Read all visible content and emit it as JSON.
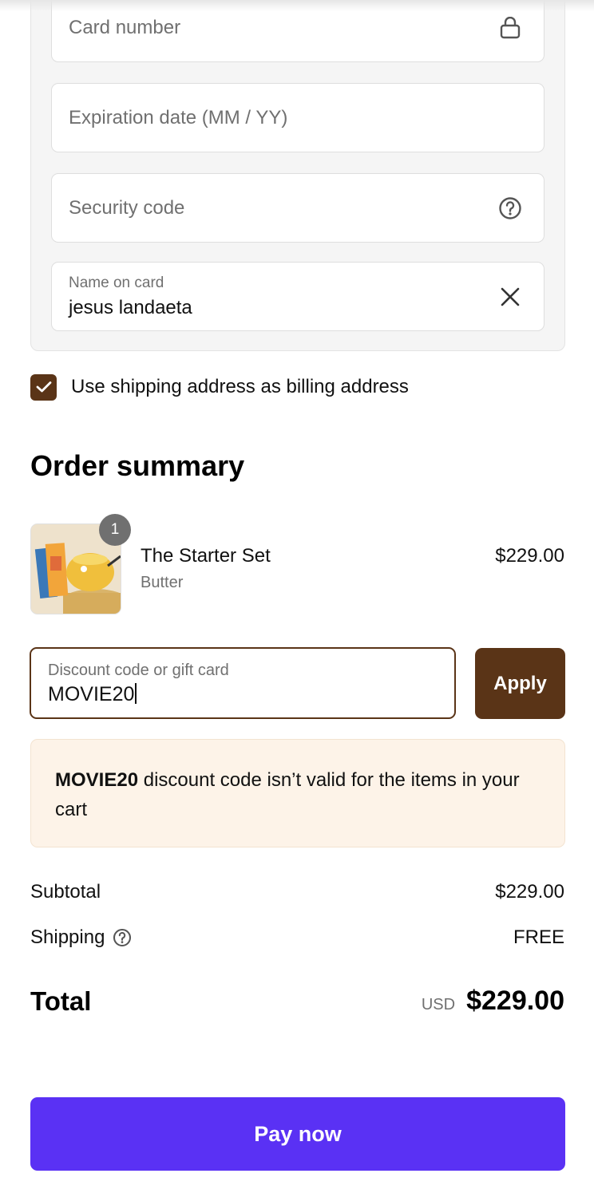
{
  "payment": {
    "card_number_placeholder": "Card number",
    "expiration_placeholder": "Expiration date (MM / YY)",
    "security_code_placeholder": "Security code",
    "name_label": "Name on card",
    "name_value": "jesus landaeta",
    "icons": {
      "card_number": "lock-icon",
      "security_code": "help-circle-icon",
      "name": "close-icon"
    }
  },
  "billing": {
    "checked": true,
    "label": "Use shipping address as billing address"
  },
  "order_summary": {
    "title": "Order summary",
    "item": {
      "quantity": "1",
      "name": "The Starter Set",
      "variant": "Butter",
      "price": "$229.00"
    },
    "discount": {
      "label": "Discount code or gift card",
      "value": "MOVIE20",
      "apply_label": "Apply"
    },
    "notice": {
      "code": "MOVIE20",
      "message": " discount code isn’t valid for the items in your cart"
    },
    "subtotal_label": "Subtotal",
    "subtotal_value": "$229.00",
    "shipping_label": "Shipping",
    "shipping_value": "FREE",
    "total_label": "Total",
    "currency": "USD",
    "total_value": "$229.00"
  },
  "pay_button": "Pay now",
  "colors": {
    "brand_brown": "#5a3417",
    "pay_purple": "#5a31f4",
    "notice_bg": "#fdf3e8"
  }
}
